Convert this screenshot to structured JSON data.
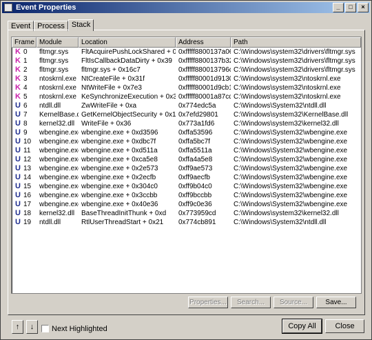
{
  "window": {
    "title": "Event Properties",
    "controls": [
      "_",
      "□",
      "×"
    ]
  },
  "tabs": [
    "Event",
    "Process",
    "Stack"
  ],
  "columns": [
    "Frame",
    "Module",
    "Location",
    "Address",
    "Path"
  ],
  "rows": [
    {
      "m": "K",
      "frame": "0",
      "module": "fltmgr.sys",
      "location": "FltAcquirePushLockShared + 0x907",
      "address": "0xfffff8800137a067",
      "path": "C:\\Windows\\system32\\drivers\\fltmgr.sys"
    },
    {
      "m": "K",
      "frame": "1",
      "module": "fltmgr.sys",
      "location": "FltIsCallbackDataDirty + 0x39",
      "address": "0xfffff8800137b329",
      "path": "C:\\Windows\\system32\\drivers\\fltmgr.sys"
    },
    {
      "m": "K",
      "frame": "2",
      "module": "fltmgr.sys",
      "location": "fltmgr.sys + 0x16c7",
      "address": "0xfffff880013796c7",
      "path": "C:\\Windows\\system32\\drivers\\fltmgr.sys"
    },
    {
      "m": "K",
      "frame": "3",
      "module": "ntoskrnl.exe",
      "location": "NtCreateFile + 0x31f",
      "address": "0xfffff80001d9130b",
      "path": "C:\\Windows\\system32\\ntoskrnl.exe"
    },
    {
      "m": "K",
      "frame": "4",
      "module": "ntoskrnl.exe",
      "location": "NtWriteFile + 0x7e3",
      "address": "0xfffff80001d9cb13",
      "path": "C:\\Windows\\system32\\ntoskrnl.exe"
    },
    {
      "m": "K",
      "frame": "5",
      "module": "ntoskrnl.exe",
      "location": "KeSynchronizeExecution + 0x3a23",
      "address": "0xfffff80001a87cd3",
      "path": "C:\\Windows\\system32\\ntoskrnl.exe"
    },
    {
      "m": "U",
      "frame": "6",
      "module": "ntdll.dll",
      "location": "ZwWriteFile + 0xa",
      "address": "0x774edc5a",
      "path": "C:\\Windows\\System32\\ntdll.dll"
    },
    {
      "m": "U",
      "frame": "7",
      "module": "KernelBase.dll",
      "location": "GetKernelObjectSecurity + 0x171",
      "address": "0x7efd29801",
      "path": "C:\\Windows\\system32\\KernelBase.dll"
    },
    {
      "m": "U",
      "frame": "8",
      "module": "kernel32.dll",
      "location": "WriteFile + 0x36",
      "address": "0x773a1fd6",
      "path": "C:\\Windows\\system32\\kernel32.dll"
    },
    {
      "m": "U",
      "frame": "9",
      "module": "wbengine.exe",
      "location": "wbengine.exe + 0xd3596",
      "address": "0xffa53596",
      "path": "C:\\Windows\\System32\\wbengine.exe"
    },
    {
      "m": "U",
      "frame": "10",
      "module": "wbengine.exe",
      "location": "wbengine.exe + 0xdbc7f",
      "address": "0xffa5bc7f",
      "path": "C:\\Windows\\System32\\wbengine.exe"
    },
    {
      "m": "U",
      "frame": "11",
      "module": "wbengine.exe",
      "location": "wbengine.exe + 0xd511a",
      "address": "0xffa5511a",
      "path": "C:\\Windows\\System32\\wbengine.exe"
    },
    {
      "m": "U",
      "frame": "12",
      "module": "wbengine.exe",
      "location": "wbengine.exe + 0xca5e8",
      "address": "0xffa4a5e8",
      "path": "C:\\Windows\\System32\\wbengine.exe"
    },
    {
      "m": "U",
      "frame": "13",
      "module": "wbengine.exe",
      "location": "wbengine.exe + 0x2e573",
      "address": "0xff9ae573",
      "path": "C:\\Windows\\System32\\wbengine.exe"
    },
    {
      "m": "U",
      "frame": "14",
      "module": "wbengine.exe",
      "location": "wbengine.exe + 0x2ecfb",
      "address": "0xff9aecfb",
      "path": "C:\\Windows\\System32\\wbengine.exe"
    },
    {
      "m": "U",
      "frame": "15",
      "module": "wbengine.exe",
      "location": "wbengine.exe + 0x304c0",
      "address": "0xff9b04c0",
      "path": "C:\\Windows\\System32\\wbengine.exe"
    },
    {
      "m": "U",
      "frame": "16",
      "module": "wbengine.exe",
      "location": "wbengine.exe + 0x3ccbb",
      "address": "0xff9bccbb",
      "path": "C:\\Windows\\System32\\wbengine.exe"
    },
    {
      "m": "U",
      "frame": "17",
      "module": "wbengine.exe",
      "location": "wbengine.exe + 0x40e36",
      "address": "0xff9c0e36",
      "path": "C:\\Windows\\System32\\wbengine.exe"
    },
    {
      "m": "U",
      "frame": "18",
      "module": "kernel32.dll",
      "location": "BaseThreadInitThunk + 0xd",
      "address": "0x773959cd",
      "path": "C:\\Windows\\system32\\kernel32.dll"
    },
    {
      "m": "U",
      "frame": "19",
      "module": "ntdll.dll",
      "location": "RtlUserThreadStart + 0x21",
      "address": "0x774cb891",
      "path": "C:\\Windows\\System32\\ntdll.dll"
    }
  ],
  "buttons": {
    "properties": "Properties...",
    "search": "Search...",
    "source": "Source...",
    "save": "Save...",
    "up": "↑",
    "down": "↓",
    "copy_all": "Copy All",
    "close": "Close"
  },
  "checkbox": {
    "label": "Next Highlighted",
    "checked": false
  },
  "colors": {
    "kernel_marker": "#c81ea8",
    "user_marker": "#1c2a8c",
    "title_bar": "#0a246a"
  }
}
